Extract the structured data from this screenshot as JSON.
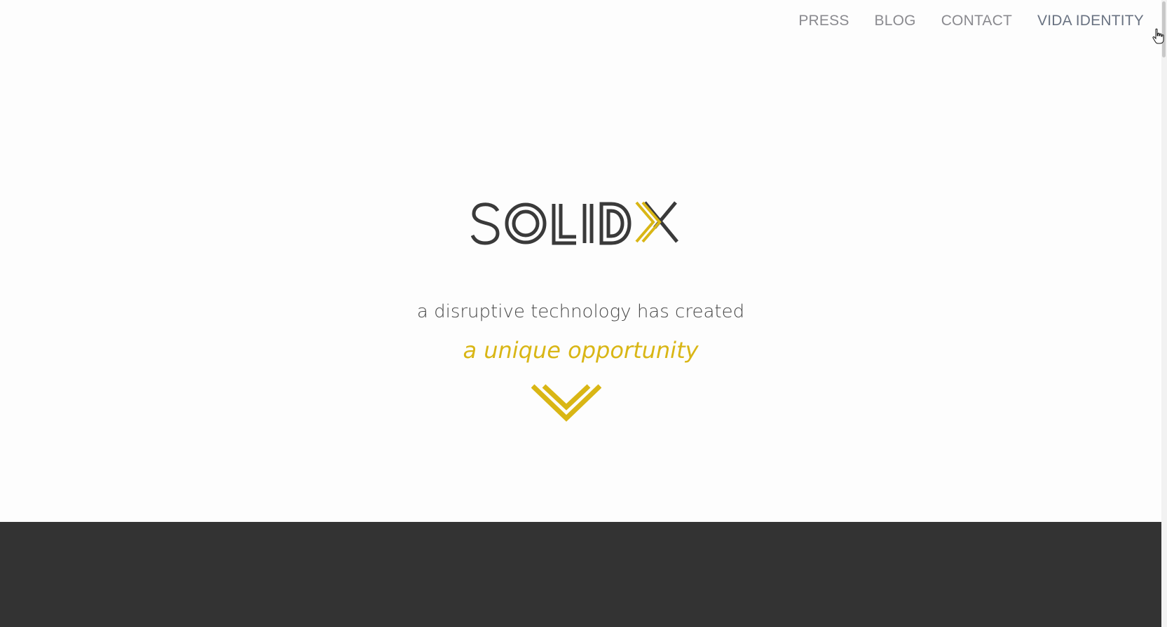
{
  "nav": {
    "items": [
      {
        "label": "PRESS"
      },
      {
        "label": "BLOG"
      },
      {
        "label": "CONTACT"
      },
      {
        "label": "VIDA IDENTITY"
      }
    ]
  },
  "hero": {
    "logo_text": "SOLIDX",
    "tagline": "a disruptive technology has created",
    "highlight": "a unique opportunity"
  },
  "icons": {
    "scroll": "chevron-down-icon",
    "cursor": "hand-pointer-icon"
  },
  "colors": {
    "accent": "#d9b615",
    "text_dark": "#3a3a3a",
    "nav_text": "#8a8a8f",
    "dark_section": "#333333",
    "background": "#fdfdfd"
  }
}
